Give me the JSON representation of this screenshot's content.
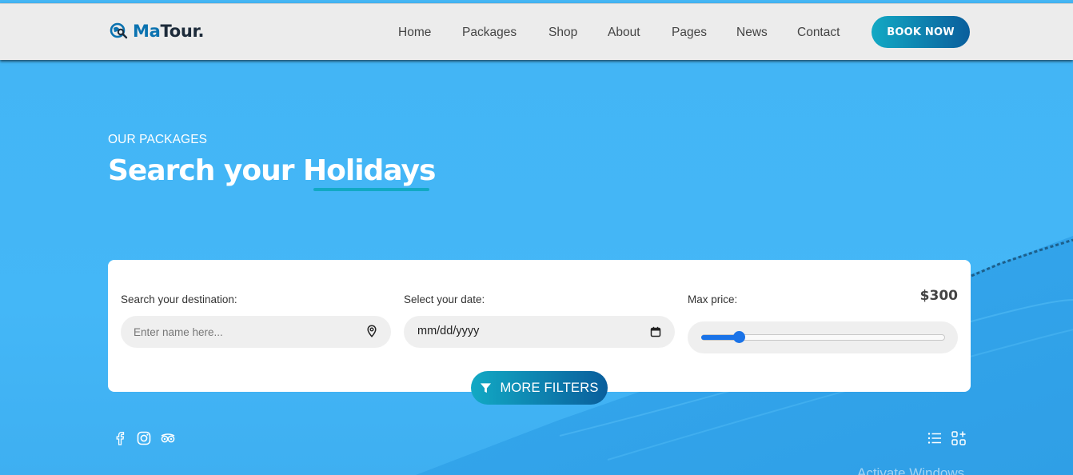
{
  "header": {
    "logo": {
      "accent": "Ma",
      "rest": "Tour."
    },
    "nav": [
      "Home",
      "Packages",
      "Shop",
      "About",
      "Pages",
      "News",
      "Contact"
    ],
    "book_button": "BOOK NOW"
  },
  "hero": {
    "eyebrow": "OUR PACKAGES",
    "title": "Search your Holidays"
  },
  "search": {
    "destination_label": "Search your destination:",
    "destination_placeholder": "Enter name here...",
    "date_label": "Select your date:",
    "date_value": "mm/dd/yyyy",
    "price_label": "Max price:",
    "price_value": "$300",
    "price_fraction": 0.155,
    "more_filters": "MORE FILTERS"
  },
  "social_icons": [
    "facebook-icon",
    "instagram-icon",
    "tripadvisor-icon"
  ],
  "view_icons": [
    "list-view-icon",
    "grid-view-icon"
  ],
  "watermark": "Activate Windows",
  "colors": {
    "accent": "#0a72b0",
    "button_start": "#12a9c4",
    "button_end": "#0a5e9c",
    "hero": "#45b6f4",
    "slider": "#1a73e8"
  }
}
